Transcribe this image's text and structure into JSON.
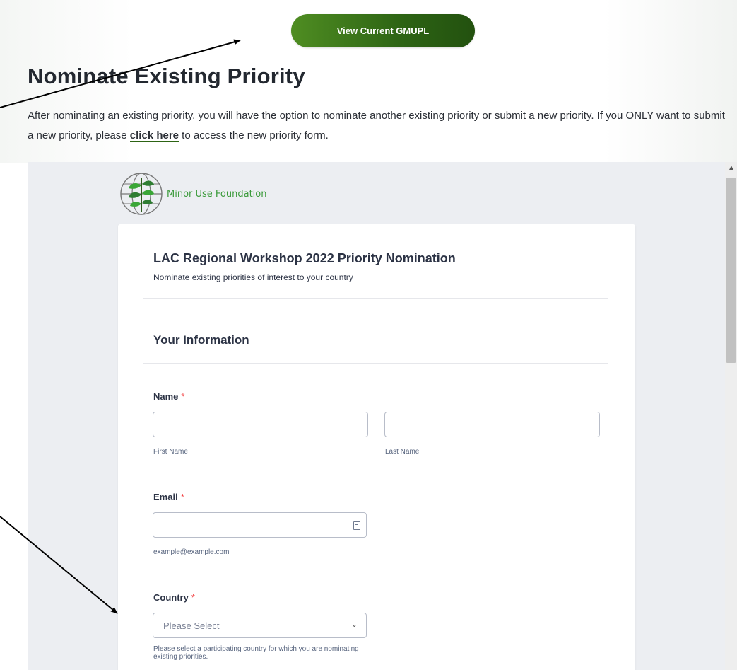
{
  "header": {
    "view_button_label": "View Current GMUPL",
    "page_title": "Nominate Existing Priority",
    "intro_part1": "After nominating an existing priority, you will have the option to nominate another existing priority or submit a new priority. If you ",
    "intro_only": "ONLY",
    "intro_part2": " want to submit a new priority, please ",
    "intro_link": "click here",
    "intro_part3": " to access the new priority form."
  },
  "form": {
    "org_name": "Minor Use Foundation",
    "title": "LAC Regional Workshop 2022 Priority Nomination",
    "subtitle": "Nominate existing priorities of interest to your country",
    "section_title": "Your Information",
    "required_mark": "*",
    "name_label": "Name",
    "first_name_sublabel": "First Name",
    "last_name_sublabel": "Last Name",
    "email_label": "Email",
    "email_sublabel": "example@example.com",
    "country_label": "Country",
    "country_selected": "Please Select",
    "country_help": "Please select a participating country for which you are nominating existing priorities."
  },
  "colors": {
    "button_green": "#2d6414",
    "required_red": "#f23a3c",
    "logo_green": "#3a9a3a"
  },
  "icons": [
    "leaf-globe-logo-icon",
    "email-card-icon",
    "chevron-down-icon",
    "scroll-up-icon"
  ]
}
